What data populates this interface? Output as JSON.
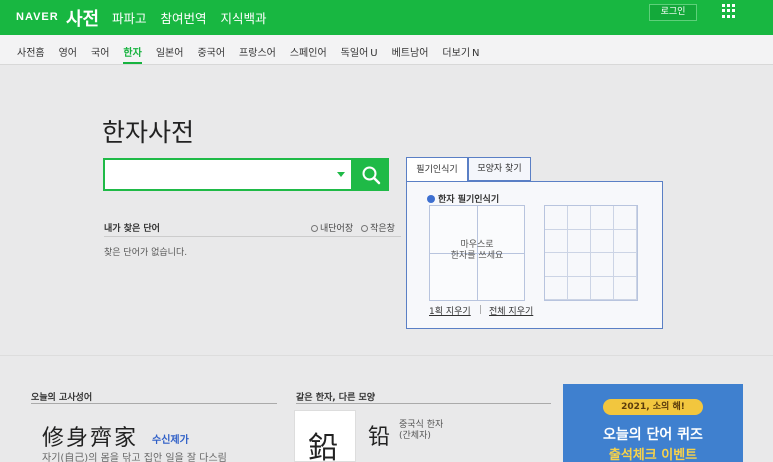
{
  "header": {
    "brand": "NAVER",
    "title": "사전",
    "nav": [
      "파파고",
      "참여번역",
      "지식백과"
    ],
    "login_label": "로그인",
    "apps_icon": "apps-grid-icon"
  },
  "lang_tabs": {
    "items": [
      "사전홈",
      "영어",
      "국어",
      "한자",
      "일본어",
      "중국어",
      "프랑스어",
      "스페인어",
      "독일어",
      "베트남어",
      "더보기"
    ],
    "active": "한자",
    "badge_u": "U",
    "badge_n": "N"
  },
  "main": {
    "title": "한자사전",
    "search_placeholder": "",
    "search_icon": "search-icon"
  },
  "recent": {
    "label": "내가 찾은 단어",
    "options": [
      "내단어장",
      "작은창"
    ],
    "empty_text": "찾은 단어가 없습니다."
  },
  "handwriting": {
    "tab_handwriting": "필기인식기",
    "tab_shape": "모양자 찾기",
    "title": "한자 필기인식기",
    "hint_line1": "마우스로",
    "hint_line2": "한자를 쓰세요",
    "clear_one": "1획 지우기",
    "separator": "|",
    "clear_all": "전체 지우기"
  },
  "idiom": {
    "label": "오늘의 고사성어",
    "hanja": "修身齊家",
    "reading": "수신제가",
    "meaning": "자기(自己)의 몸을 닦고 집안 일을 잘 다스림"
  },
  "same_hanja": {
    "label": "같은 한자, 다른 모양",
    "big_char": "鉛",
    "small_char": "铅",
    "desc_line1": "중국식 한자",
    "desc_line2": "(간체자)"
  },
  "banner": {
    "pill": "2021, 소의 해!",
    "title": "오늘의 단어 퀴즈",
    "subtitle": "출석체크 이벤트"
  },
  "colors": {
    "naver_green": "#18b741",
    "panel_blue": "#5a7fc5",
    "banner_blue": "#3f80cf",
    "link_blue": "#2f5fc7"
  }
}
